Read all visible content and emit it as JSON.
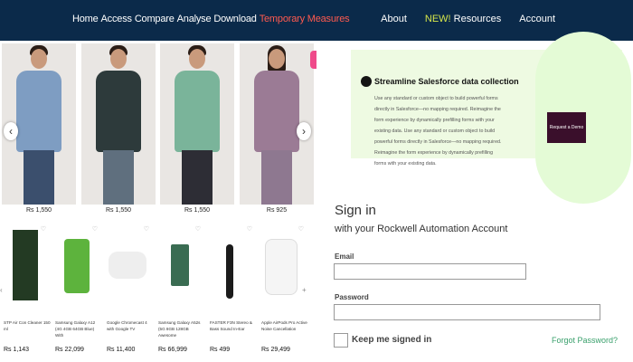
{
  "nav": {
    "left_items": [
      "Home",
      "Access",
      "Compare",
      "Analyse",
      "Download"
    ],
    "accent_item": "Temporary Measures",
    "about": "About",
    "new_badge": "NEW!",
    "resources": "Resources",
    "account": "Account"
  },
  "carousel": {
    "prev_icon": "‹",
    "next_icon": "›",
    "products": [
      {
        "price": "Rs 1,550",
        "shirt_color": "#7e9dc2",
        "pants_color": "#3b4f6d"
      },
      {
        "price": "Rs 1,550",
        "shirt_color": "#2d3a3b",
        "pants_color": "#5f6f7e"
      },
      {
        "price": "Rs 1,550",
        "shirt_color": "#7ab49a",
        "pants_color": "#2d2d35"
      },
      {
        "price": "Rs 925",
        "shirt_color": "#9b7b95",
        "pants_color": "#8e7890"
      }
    ]
  },
  "grid": {
    "next_icon": "+",
    "prev_icon": "‹",
    "items": [
      {
        "name": "STP Air Con Cleaner 150 ml",
        "price": "Rs 1,143",
        "color": "#233a23",
        "heart": "♡"
      },
      {
        "name": "Samsung Galaxy A12 (4G 4GB 64GB Blue) With",
        "price": "Rs 22,099",
        "color": "#5db33d",
        "heart": "♡"
      },
      {
        "name": "Google Chromecast 4 with Google TV",
        "price": "Rs 11,400",
        "color": "#eeeeee",
        "heart": "♡"
      },
      {
        "name": "Samsung Galaxy A52s (5G 8GB 128GB Awesome",
        "price": "Rs 66,999",
        "color": "#3a6c52",
        "heart": "♡"
      },
      {
        "name": "FASTER F3N Stereo & Bass Sound In-Ear",
        "price": "Rs 499",
        "color": "#1b1b1b",
        "heart": "♡"
      },
      {
        "name": "Apple AirPods Pro Active Noise Cancellation",
        "price": "Rs 29,499",
        "color": "#f5f5f5",
        "heart": "♡"
      }
    ]
  },
  "promo": {
    "title": "Streamline Salesforce data collection",
    "text": "Use any standard or custom object to build powerful forms directly in Salesforce—no mapping required. Reimagine the form experience by dynamically prefilling forms with your existing data. Use any standard or custom object to build powerful forms directly in Salesforce—no mapping required. Reimagine the form experience by dynamically prefilling forms with your existing data.",
    "button": "Request a Demo"
  },
  "signin": {
    "title": "Sign in",
    "subtitle": "with your Rockwell Automation Account",
    "email_label": "Email",
    "email_value": "",
    "password_label": "Password",
    "password_value": "",
    "keep_signed_in": "Keep me signed in",
    "forgot": "Forgot Password?"
  }
}
